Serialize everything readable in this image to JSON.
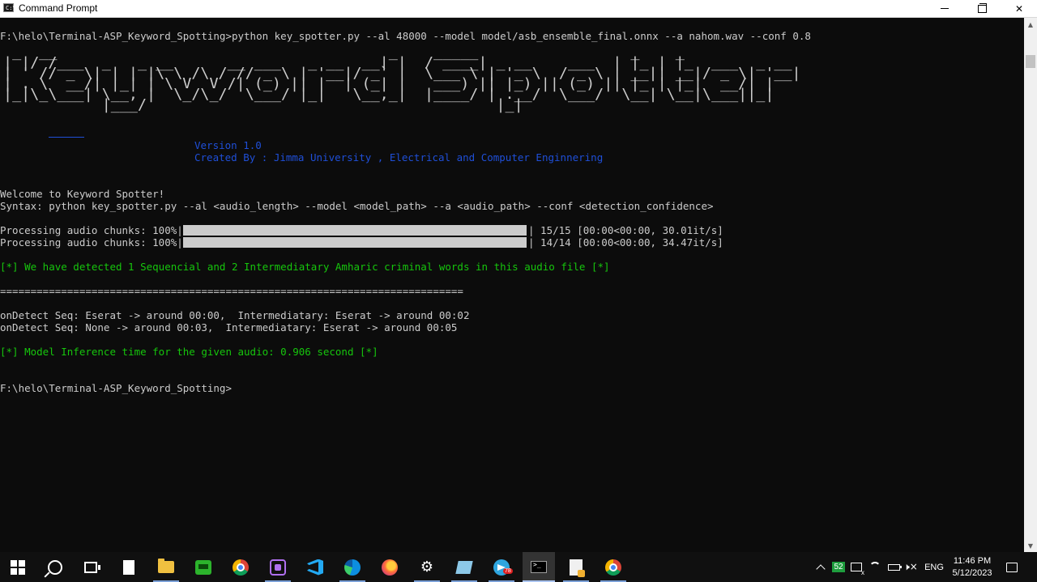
{
  "window": {
    "title": "Command Prompt",
    "app_icon_text": "C:\\"
  },
  "console": {
    "command_line": "F:\\helo\\Terminal-ASP_Keyword_Spotting>python key_spotter.py --al 48000 --model model/asb_ensemble_final.onnx --a nahom.wav --conf 0.8",
    "ascii_art": " _  __                                     _    _____                 _    _             \n| |/ /___  _   _ __      __ ___   _ __  __| |  / ____| _ __    ___  | |_ | |_  ___  _ __ \n| ' // _ \\| | | |\\ \\ /\\ / // _ \\ | '__|/ _` |  \\___ \\ | '_ \\  / _ \\ | __|| __|/ _ \\| '__|\n| . \\  __/| |_| | \\ V  V /| (_) || |  | (_| |   ___) || |_) || (_) || |_ | |_|  __/| |   \n|_|\\_\\___| \\__, |  \\_/\\_/  \\___/ |_|   \\__,_|  |____/ | .__/  \\___/  \\__| \\__|\\___||_|   \n           |___/                                       |_|                                ",
    "version": "Version 1.0",
    "created_by": "Created By : Jimma University , Electrical and Computer Enginnering",
    "welcome": "Welcome to Keyword Spotter!",
    "syntax": "Syntax: python key_spotter.py --al <audio_length> --model <model_path> --a <audio_path> --conf <detection_confidence>",
    "progress": [
      {
        "label": "Processing audio chunks: 100%|",
        "fraction": 1.0,
        "suffix": "| 15/15 [00:00<00:00, 30.01it/s]"
      },
      {
        "label": "Processing audio chunks: 100%|",
        "fraction": 1.0,
        "suffix": "| 14/14 [00:00<00:00, 34.47it/s]"
      }
    ],
    "detected": "[*] We have detected 1 Sequencial and 2 Intermediatary Amharic criminal words in this audio file [*]",
    "separator": "============================================================================",
    "detections": [
      "onDetect Seq: Eserat -> around 00:00,  Intermediatary: Eserat -> around 00:02",
      "onDetect Seq: None -> around 00:03,  Intermediatary: Eserat -> around 00:05"
    ],
    "inference": "[*] Model Inference time for the given audio: 0.906 second [*]",
    "prompt": "F:\\helo\\Terminal-ASP_Keyword_Spotting>"
  },
  "colors": {
    "background": "#0c0c0c",
    "text": "#cccccc",
    "blue": "#1f4fd8",
    "green": "#16c60c"
  },
  "taskbar": {
    "apps": [
      {
        "name": "start",
        "icon": "windows-icon"
      },
      {
        "name": "search",
        "icon": "search-icon"
      },
      {
        "name": "task-view",
        "icon": "task-view-icon"
      },
      {
        "name": "file",
        "icon": "file-icon"
      },
      {
        "name": "file-explorer",
        "icon": "folder-icon"
      },
      {
        "name": "green-app",
        "icon": "green-app-icon"
      },
      {
        "name": "chrome",
        "icon": "chrome-icon"
      },
      {
        "name": "purple-app",
        "icon": "purple-app-icon"
      },
      {
        "name": "vscode",
        "icon": "vscode-icon"
      },
      {
        "name": "edge",
        "icon": "edge-icon"
      },
      {
        "name": "firefox",
        "icon": "firefox-icon"
      },
      {
        "name": "settings",
        "icon": "gear-icon"
      },
      {
        "name": "notebook",
        "icon": "notebook-icon"
      },
      {
        "name": "telegram",
        "icon": "telegram-icon",
        "badge": "78"
      },
      {
        "name": "command-prompt",
        "icon": "terminal-icon"
      },
      {
        "name": "documents",
        "icon": "documents-icon"
      },
      {
        "name": "chrome-2",
        "icon": "chrome-icon"
      }
    ],
    "tray": {
      "badge": "52",
      "language": "ENG",
      "time": "11:46 PM",
      "date": "5/12/2023",
      "volume_icon": "🕨×"
    }
  }
}
